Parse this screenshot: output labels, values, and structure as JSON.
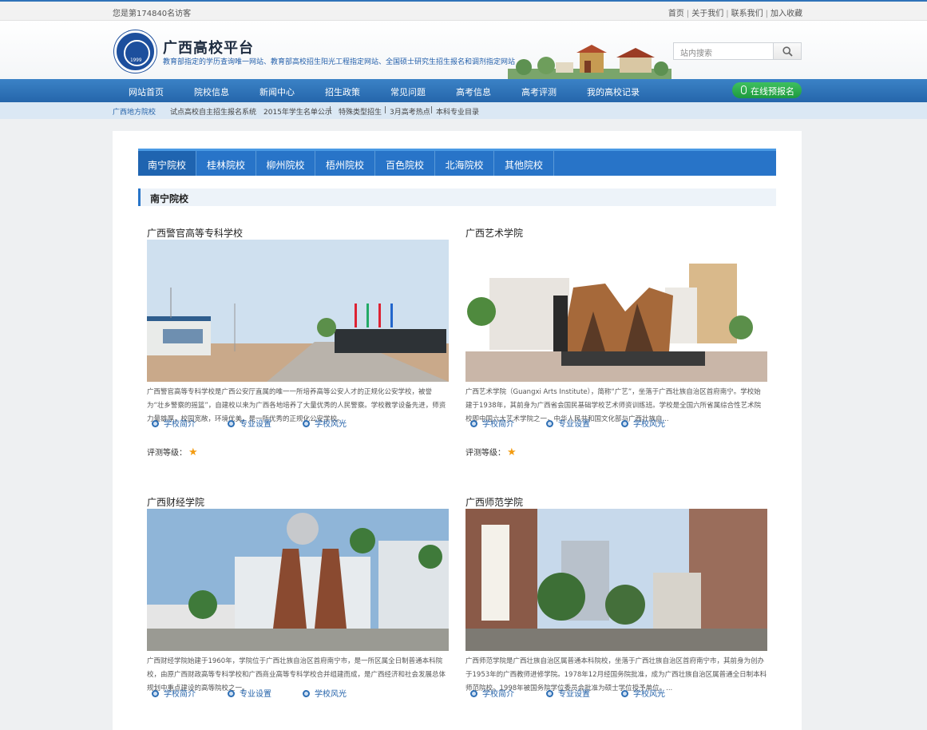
{
  "topbar": {
    "visitors": "您是第174840名访客",
    "links": [
      "首页",
      "关于我们",
      "联系我们",
      "加入收藏"
    ]
  },
  "header": {
    "logo_year": "1999",
    "title": "广西高校平台",
    "subtitle": "教育部指定的学历查询唯一网站、教育部高校招生阳光工程指定网站、全国硕士研究生招生报名和调剂指定网站",
    "search_placeholder": "站内搜索"
  },
  "nav": {
    "items": [
      "网站首页",
      "院校信息",
      "新闻中心",
      "招生政策",
      "常见问题",
      "高考信息",
      "高考评测",
      "我的高校记录"
    ],
    "pre_register": "在线预报名"
  },
  "subnav": {
    "current": "广西地方院校",
    "items": [
      "试点高校自主招生报名系统",
      "2015年学生名单公示",
      "特殊类型招生",
      "3月高考热点",
      "本科专业目录"
    ]
  },
  "tabs": [
    "南宁院校",
    "桂林院校",
    "柳州院校",
    "梧州院校",
    "百色院校",
    "北海院校",
    "其他院校"
  ],
  "section_title": "南宁院校",
  "card_links": [
    "学校简介",
    "专业设置",
    "学校风光"
  ],
  "rating_label": "评测等级：",
  "colors": {
    "primary": "#2874c8",
    "nav": "#2566ab",
    "accent_green": "#1d9a3e",
    "star": "#f39c12"
  },
  "schools": [
    {
      "name": "广西警官高等专科学校",
      "desc": "广西警官高等专科学校是广西公安厅直属的唯一一所培养高等公安人才的正规化公安学校，被誉为“壮乡警察的摇篮”，自建校以来为广西各地培养了大量优秀的人民警察。学校教学设备先进，师资力量雄厚，校园宽敞，环境优美，是一所优秀的正规化公安学校。",
      "rating": 1
    },
    {
      "name": "广西艺术学院",
      "desc": "广西艺术学院（Guangxi Arts Institute），简称“广艺”，坐落于广西壮族自治区首府南宁。学校始建于1938年，其前身为广西省会国民基础学校艺术师资训练班。学校是全国六所省属综合性艺术院校即中国六大艺术学院之一，中华人民共和国文化部与广西壮族自...",
      "rating": 1
    },
    {
      "name": "广西财经学院",
      "desc": "广西财经学院始建于1960年，学院位于广西壮族自治区首府南宁市，是一所区属全日制普通本科院校，由原广西财政高等专科学校和广西商业高等专科学校合并组建而成，是广西经济和社会发展总体规划中重点建设的高等院校之一。"
    },
    {
      "name": "广西师范学院",
      "desc": "广西师范学院是广西壮族自治区属普通本科院校，坐落于广西壮族自治区首府南宁市，其前身为创办于1953年的广西教师进修学院。1978年12月经国务院批准，成为广西壮族自治区属普通全日制本科师范院校。1998年被国务院学位委员会批准为硕士学位授予单位。..."
    }
  ]
}
